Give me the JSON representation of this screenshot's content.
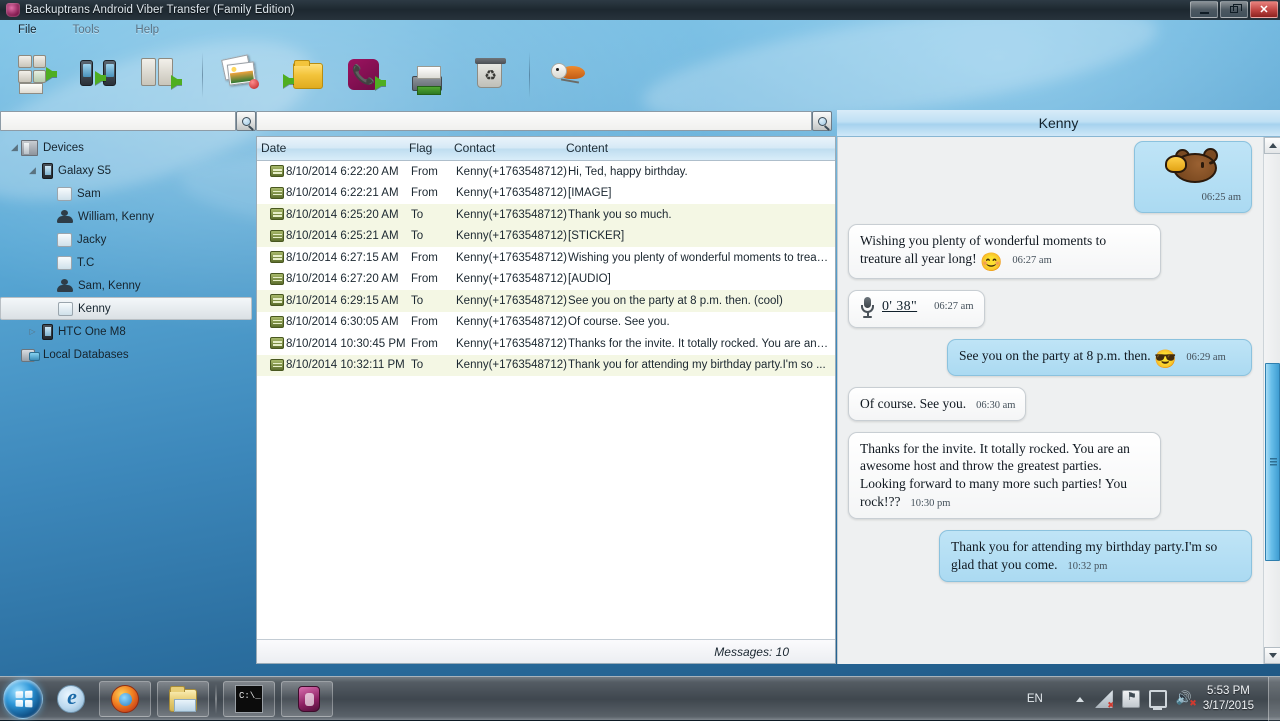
{
  "window": {
    "title": "Backuptrans Android Viber Transfer (Family Edition)",
    "app_icon": "viber-app-icon",
    "buttons": {
      "minimize": "minimize",
      "restore": "restore",
      "close": "✕"
    }
  },
  "menubar": {
    "items": [
      "File",
      "Tools",
      "Help"
    ]
  },
  "toolbar": {
    "buttons": [
      {
        "name": "backup-messages-icon",
        "label": "Backup Messages"
      },
      {
        "name": "transfer-device-to-device-icon",
        "label": "Transfer Device to Device"
      },
      {
        "name": "restore-messages-icon",
        "label": "Restore Messages"
      },
      {
        "name": "export-photos-icon",
        "label": "Export Photos"
      },
      {
        "name": "export-to-folder-icon",
        "label": "Export to Folder"
      },
      {
        "name": "viber-icon",
        "label": "Viber"
      },
      {
        "name": "print-messages-icon",
        "label": "Print Messages"
      },
      {
        "name": "delete-messages-icon",
        "label": "Delete Messages"
      },
      {
        "name": "help-bird-icon",
        "label": "Help"
      }
    ]
  },
  "search": {
    "left": {
      "value": "",
      "placeholder": "",
      "button": "search-icon"
    },
    "right": {
      "value": "",
      "placeholder": "",
      "button": "search-icon"
    }
  },
  "tree": {
    "nodes": [
      {
        "label": "Devices",
        "icon": "devices-icon",
        "indent": 0,
        "twisty": "open",
        "selected": false
      },
      {
        "label": "Galaxy S5",
        "icon": "phone-icon",
        "indent": 1,
        "twisty": "open",
        "selected": false
      },
      {
        "label": "Sam",
        "icon": "contact-icon",
        "indent": 2,
        "twisty": "none",
        "selected": false
      },
      {
        "label": "William, Kenny",
        "icon": "group-icon",
        "indent": 2,
        "twisty": "none",
        "selected": false
      },
      {
        "label": "Jacky",
        "icon": "contact-icon",
        "indent": 2,
        "twisty": "none",
        "selected": false
      },
      {
        "label": "T.C",
        "icon": "contact-icon",
        "indent": 2,
        "twisty": "none",
        "selected": false
      },
      {
        "label": "Sam, Kenny",
        "icon": "group-icon",
        "indent": 2,
        "twisty": "none",
        "selected": false
      },
      {
        "label": "Kenny",
        "icon": "contact-icon",
        "indent": 2,
        "twisty": "none",
        "selected": true
      },
      {
        "label": "HTC One M8",
        "icon": "phone-icon",
        "indent": 1,
        "twisty": "closed",
        "selected": false
      },
      {
        "label": "Local Databases",
        "icon": "database-icon",
        "indent": 0,
        "twisty": "none",
        "selected": false
      }
    ]
  },
  "list": {
    "columns": [
      "Date",
      "Flag",
      "Contact",
      "Content"
    ],
    "rows": [
      {
        "date": "8/10/2014 6:22:20 AM",
        "flag": "From",
        "contact": "Kenny(+1763548712)",
        "content": "Hi, Ted, happy birthday."
      },
      {
        "date": "8/10/2014 6:22:21 AM",
        "flag": "From",
        "contact": "Kenny(+1763548712)",
        "content": "[IMAGE]"
      },
      {
        "date": "8/10/2014 6:25:20 AM",
        "flag": "To",
        "contact": "Kenny(+1763548712)",
        "content": "Thank you so much."
      },
      {
        "date": "8/10/2014 6:25:21 AM",
        "flag": "To",
        "contact": "Kenny(+1763548712)",
        "content": "[STICKER]"
      },
      {
        "date": "8/10/2014 6:27:15 AM",
        "flag": "From",
        "contact": "Kenny(+1763548712)",
        "content": "Wishing you plenty of wonderful moments to treat..."
      },
      {
        "date": "8/10/2014 6:27:20 AM",
        "flag": "From",
        "contact": "Kenny(+1763548712)",
        "content": "[AUDIO]"
      },
      {
        "date": "8/10/2014 6:29:15 AM",
        "flag": "To",
        "contact": "Kenny(+1763548712)",
        "content": "See you on the party at 8 p.m. then. (cool)"
      },
      {
        "date": "8/10/2014 6:30:05 AM",
        "flag": "From",
        "contact": "Kenny(+1763548712)",
        "content": "Of course. See you."
      },
      {
        "date": "8/10/2014 10:30:45 PM",
        "flag": "From",
        "contact": "Kenny(+1763548712)",
        "content": "Thanks for the invite. It totally rocked. You are an a..."
      },
      {
        "date": "8/10/2014 10:32:11 PM",
        "flag": "To",
        "contact": "Kenny(+1763548712)",
        "content": "Thank you for attending my birthday party.I'm so ..."
      }
    ],
    "status": "Messages: 10"
  },
  "chat": {
    "title": "Kenny",
    "messages": [
      {
        "dir": "out",
        "kind": "sticker",
        "sticker": "bear-sticker",
        "text": "",
        "time": "06:25 am"
      },
      {
        "dir": "in",
        "kind": "text",
        "text": "Wishing you plenty of wonderful moments to treature all year long!",
        "emoji": "😊",
        "time": "06:27 am"
      },
      {
        "dir": "in",
        "kind": "audio",
        "duration": "0' 38\"",
        "text": "",
        "time": "06:27 am"
      },
      {
        "dir": "out",
        "kind": "text",
        "text": "See you on the party at 8 p.m. then.",
        "emoji": "😎",
        "time": "06:29 am"
      },
      {
        "dir": "in",
        "kind": "text",
        "text": "Of course. See you.",
        "emoji": "",
        "time": "06:30 am"
      },
      {
        "dir": "in",
        "kind": "text",
        "text": "Thanks for the invite. It totally rocked. You are an awesome host and throw the greatest parties. Looking forward to many more such parties! You rock!??",
        "emoji": "",
        "time": "10:30 pm"
      },
      {
        "dir": "out",
        "kind": "text",
        "text": "Thank you for attending my birthday party.I'm so glad that you come.",
        "emoji": "",
        "time": "10:32 pm"
      }
    ]
  },
  "taskbar": {
    "start": "start-orb",
    "tasks": [
      {
        "name": "internet-explorer-icon",
        "label": "Internet Explorer"
      },
      {
        "name": "firefox-icon",
        "label": "Mozilla Firefox"
      },
      {
        "name": "file-explorer-icon",
        "label": "Windows Explorer"
      },
      {
        "name": "command-prompt-icon",
        "label": "Command Prompt"
      },
      {
        "name": "viber-transfer-icon",
        "label": "Backuptrans Android Viber Transfer"
      }
    ],
    "tray": {
      "language": "EN",
      "icons": [
        "network-icon",
        "action-center-icon",
        "display-icon",
        "volume-icon"
      ],
      "time": "5:53 PM",
      "date": "3/17/2015"
    }
  },
  "colors": {
    "accent": "#3f9ed2",
    "outgoing_bubble": "#bfe4f6",
    "incoming_bubble": "#ffffff",
    "row_highlight": "#f4f7e4",
    "close_button": "#c24744"
  }
}
